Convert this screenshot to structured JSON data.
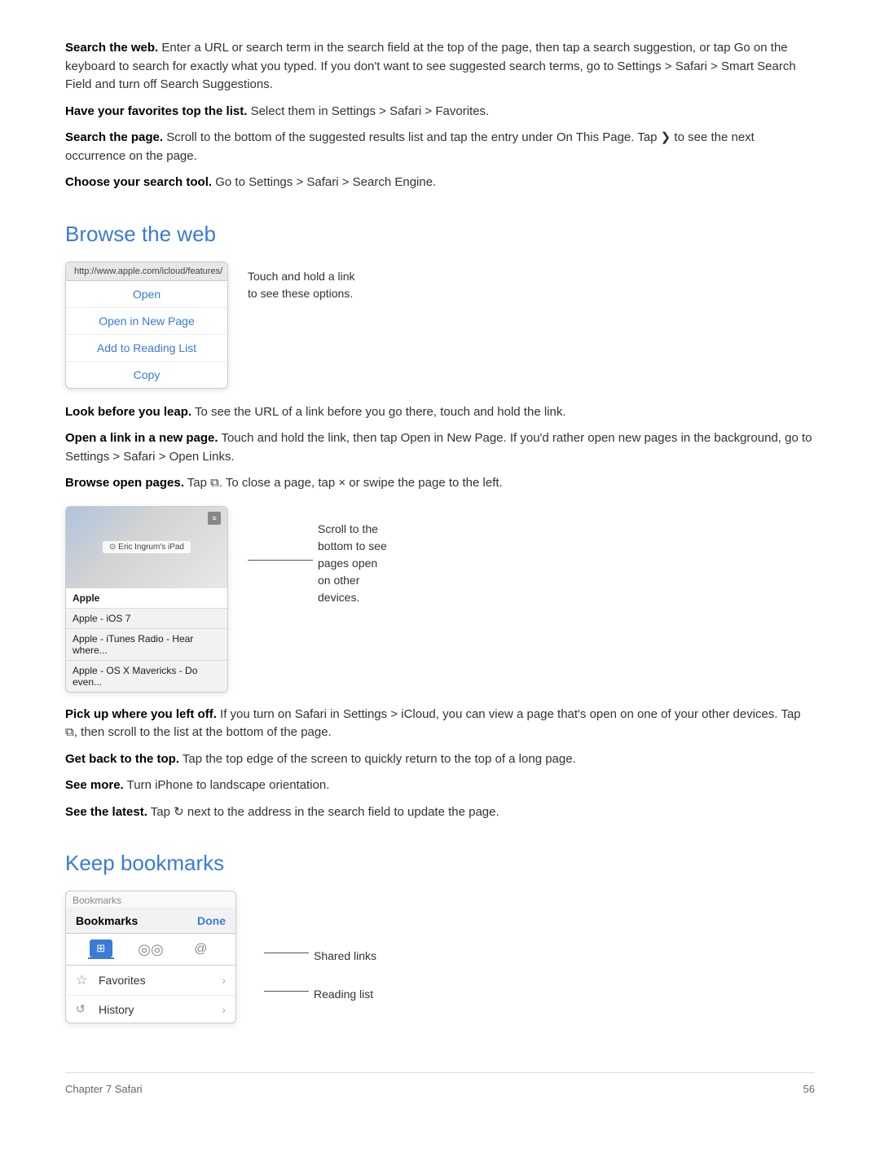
{
  "page": {
    "paragraphs": [
      {
        "id": "p1",
        "bold_prefix": "Search the web.",
        "text": " Enter a URL or search term in the search field at the top of the page, then tap a search suggestion, or tap Go on the keyboard to search for exactly what you typed. If you don't want to see suggested search terms, go to Settings > Safari > Smart Search Field and turn off Search Suggestions."
      },
      {
        "id": "p2",
        "bold_prefix": "Have your favorites top the list.",
        "text": " Select them in Settings > Safari > Favorites."
      },
      {
        "id": "p3",
        "bold_prefix": "Search the page.",
        "text": " Scroll to the bottom of the suggested results list and tap the entry under On This Page. Tap ❯ to see the next occurrence on the page."
      },
      {
        "id": "p4",
        "bold_prefix": "Choose your search tool.",
        "text": " Go to Settings > Safari > Search Engine."
      }
    ],
    "section_browse": {
      "heading": "Browse the web",
      "context_menu": {
        "url": "http://www.apple.com/icloud/features/",
        "items": [
          "Open",
          "Open in New Page",
          "Add to Reading List",
          "Copy"
        ]
      },
      "context_menu_caption": "Touch and hold a link\nto see these options.",
      "paragraphs_after": [
        {
          "id": "ba1",
          "bold_prefix": "Look before you leap.",
          "text": " To see the URL of a link before you go there, touch and hold the link."
        },
        {
          "id": "ba2",
          "bold_prefix": "Open a link in a new page.",
          "text": " Touch and hold the link, then tap Open in New Page. If you'd rather open new pages in the background, go to Settings > Safari > Open Links."
        },
        {
          "id": "ba3",
          "bold_prefix": "Browse open pages.",
          "text": " Tap ⧈. To close a page, tap × or swipe the page to the left."
        }
      ],
      "tabs_mockup": {
        "device_label": "Eric Ingrum's iPad",
        "list_items": [
          "Apple",
          "Apple - iOS 7",
          "Apple - iTunes Radio - Hear where...",
          "Apple - OS X Mavericks - Do even..."
        ]
      },
      "scroll_callout": "Scroll to the\nbottom to see\npages open\non other\ndevices.",
      "paragraphs_after2": [
        {
          "id": "ba4",
          "bold_prefix": "Pick up where you left off.",
          "text": " If you turn on Safari in Settings > iCloud, you can view a page that's open on one of your other devices. Tap ⧈, then scroll to the list at the bottom of the page."
        },
        {
          "id": "ba5",
          "bold_prefix": "Get back to the top.",
          "text": " Tap the top edge of the screen to quickly return to the top of a long page."
        },
        {
          "id": "ba6",
          "bold_prefix": "See more.",
          "text": " Turn iPhone to landscape orientation."
        },
        {
          "id": "ba7",
          "bold_prefix": "See the latest.",
          "text": " Tap ↻ next to the address in the search field to update the page."
        }
      ]
    },
    "section_bookmarks": {
      "heading": "Keep bookmarks",
      "bookmarks_mockup": {
        "header_label": "Bookmarks",
        "title": "Bookmarks",
        "done_label": "Done",
        "tabs": [
          {
            "icon": "☰",
            "active": true,
            "label": "bookmarks-tab"
          },
          {
            "icon": "◎",
            "active": false,
            "label": "reading-list-tab"
          },
          {
            "icon": "@",
            "active": false,
            "label": "shared-links-tab"
          }
        ],
        "rows": [
          {
            "icon": "☆",
            "text": "Favorites",
            "chevron": true
          },
          {
            "icon": "⟳",
            "text": "History",
            "chevron": true
          }
        ]
      },
      "callouts": [
        {
          "text": "Shared links"
        },
        {
          "text": "Reading list"
        }
      ]
    },
    "footer": {
      "chapter": "Chapter 7   Safari",
      "page_number": "56"
    }
  }
}
